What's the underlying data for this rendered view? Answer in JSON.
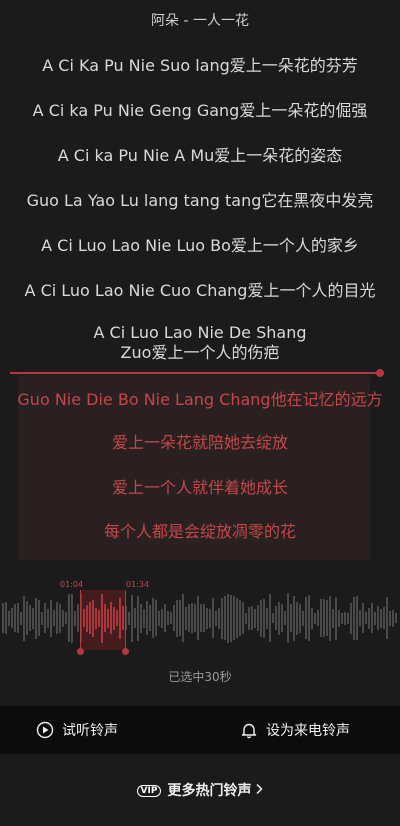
{
  "header": {
    "title": "阿朵 - 一人一花"
  },
  "lyrics": [
    "A Ci Ka Pu Nie Suo lang爱上一朵花的芬芳",
    "A Ci ka Pu Nie Geng Gang爱上一朵花的倔强",
    "A Ci ka Pu Nie A Mu爱上一朵花的姿态",
    "Guo La Yao Lu lang tang tang它在黑夜中发亮",
    "A Ci Luo Lao Nie Luo Bo爱上一个人的家乡",
    "A Ci Luo Lao Nie Cuo Chang爱上一个人的目光",
    "A Ci Luo Lao Nie De Shang",
    "Zuo爱上一个人的伤疤"
  ],
  "selected_lyrics": [
    "Guo Nie Die Bo Nie Lang Chang他在记忆的远方",
    "爱上一朵花就陪她去绽放",
    "爱上一个人就伴着她成长",
    "每个人都是会绽放凋零的花"
  ],
  "waveform": {
    "start_time": "01:04",
    "end_time": "01:34"
  },
  "selection_info": "已选中30秒",
  "actions": {
    "preview_label": "试听铃声",
    "set_ringtone_label": "设为来电铃声"
  },
  "more": {
    "vip_badge": "VIP",
    "label": "更多热门铃声"
  },
  "colors": {
    "accent": "#b23a3f",
    "background": "#1b1b1b",
    "bar": "#0c0c0c"
  }
}
